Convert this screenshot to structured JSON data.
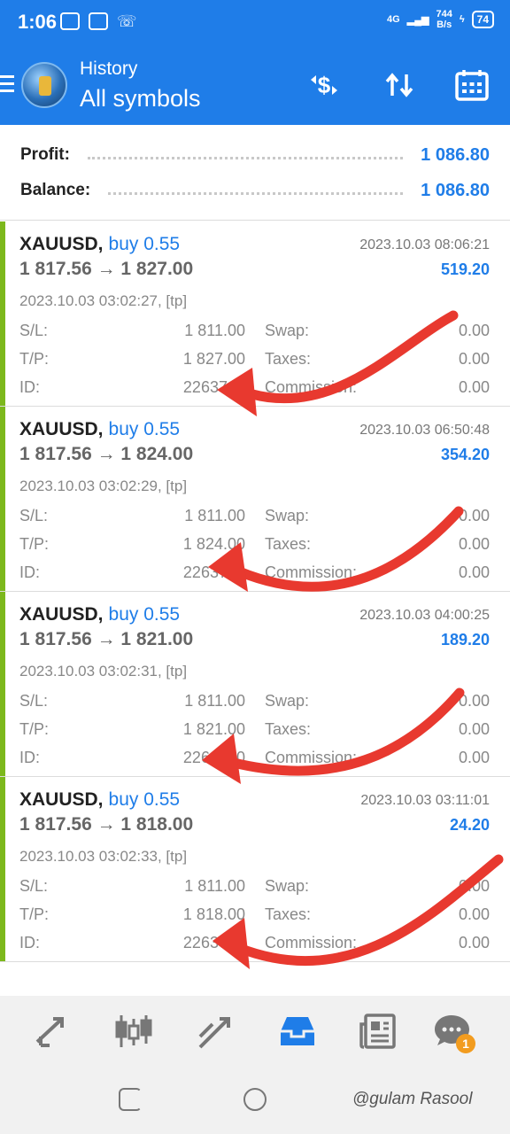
{
  "status_bar": {
    "time": "1:06",
    "net_speed_value": "744",
    "net_speed_unit": "B/s",
    "battery": "74",
    "network_label": "4G"
  },
  "toolbar": {
    "subtitle": "History",
    "title": "All symbols"
  },
  "summary": {
    "profit_label": "Profit:",
    "profit_value": "1 086.80",
    "balance_label": "Balance:",
    "balance_value": "1 086.80"
  },
  "trades": [
    {
      "symbol": "XAUUSD,",
      "side": "buy 0.55",
      "price_open": "1 817.56",
      "price_close": "1 827.00",
      "close_time": "2023.10.03 08:06:21",
      "profit": "519.20",
      "open_time": "2023.10.03 03:02:27, [tp]",
      "sl_label": "S/L:",
      "sl": "1 811.00",
      "tp_label": "T/P:",
      "tp": "1 827.00",
      "id_label": "ID:",
      "id": "2263760",
      "swap_label": "Swap:",
      "swap": "0.00",
      "taxes_label": "Taxes:",
      "taxes": "0.00",
      "commission_label": "Commission:",
      "commission": "0.00"
    },
    {
      "symbol": "XAUUSD,",
      "side": "buy 0.55",
      "price_open": "1 817.56",
      "price_close": "1 824.00",
      "close_time": "2023.10.03 06:50:48",
      "profit": "354.20",
      "open_time": "2023.10.03 03:02:29, [tp]",
      "sl_label": "S/L:",
      "sl": "1 811.00",
      "tp_label": "T/P:",
      "tp": "1 824.00",
      "id_label": "ID:",
      "id": "2263760",
      "swap_label": "Swap:",
      "swap": "0.00",
      "taxes_label": "Taxes:",
      "taxes": "0.00",
      "commission_label": "Commission:",
      "commission": "0.00"
    },
    {
      "symbol": "XAUUSD,",
      "side": "buy 0.55",
      "price_open": "1 817.56",
      "price_close": "1 821.00",
      "close_time": "2023.10.03 04:00:25",
      "profit": "189.20",
      "open_time": "2023.10.03 03:02:31, [tp]",
      "sl_label": "S/L:",
      "sl": "1 811.00",
      "tp_label": "T/P:",
      "tp": "1 821.00",
      "id_label": "ID:",
      "id": "2263760",
      "swap_label": "Swap:",
      "swap": "0.00",
      "taxes_label": "Taxes:",
      "taxes": "0.00",
      "commission_label": "Commission:",
      "commission": "0.00"
    },
    {
      "symbol": "XAUUSD,",
      "side": "buy 0.55",
      "price_open": "1 817.56",
      "price_close": "1 818.00",
      "close_time": "2023.10.03 03:11:01",
      "profit": "24.20",
      "open_time": "2023.10.03 03:02:33, [tp]",
      "sl_label": "S/L:",
      "sl": "1 811.00",
      "tp_label": "T/P:",
      "tp": "1 818.00",
      "id_label": "ID:",
      "id": "2263760",
      "swap_label": "Swap:",
      "swap": "0.00",
      "taxes_label": "Taxes:",
      "taxes": "0.00",
      "commission_label": "Commission:",
      "commission": "0.00"
    }
  ],
  "bottom_nav": {
    "active": "history",
    "chat_badge": "1"
  },
  "watermark": "@gulam Rasool",
  "colors": {
    "primary": "#1f7de8",
    "buy_bar": "#7cb81c",
    "arrow": "#e8392f"
  }
}
